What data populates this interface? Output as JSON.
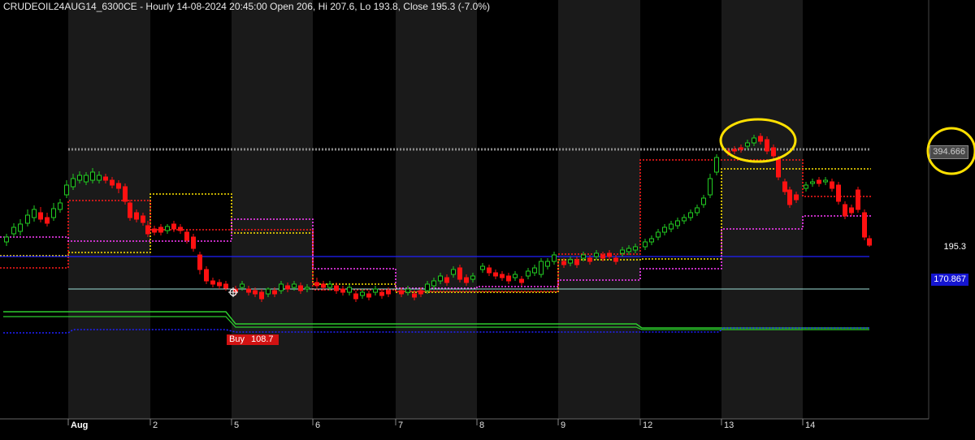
{
  "header": {
    "title": "CRUDEOIL24AUG14_6300CE - Hourly 14-08-2024 20:45:00 Open 206, Hi 207.6, Lo 193.8, Close 195.3 (-7.0%)"
  },
  "price_labels": {
    "hline": "394.666",
    "close": "195.3",
    "blue_line": "170.867"
  },
  "buy_signal": {
    "label": "Buy",
    "value": "108.7"
  },
  "colors": {
    "background": "#000000",
    "session_shade": "#1a1a1a",
    "up_candle": "#22cc22",
    "down_candle": "#ff1111",
    "yellow_level": "#ffe400",
    "red_level": "#ff1a1a",
    "magenta_level": "#ff3cff",
    "blue_line": "#2020ff",
    "cyan_line": "#9fe0d8",
    "green_band": "#2ecc2e",
    "gray_level": "#8a8a8a",
    "highlight_circle": "#ffe000"
  },
  "chart_data": {
    "type": "candlestick",
    "title": "CRUDEOIL24AUG14_6300CE - Hourly",
    "x_axis": {
      "labels": [
        "Aug",
        "2",
        "5",
        "6",
        "7",
        "8",
        "9",
        "12",
        "13",
        "14"
      ]
    },
    "levels": {
      "gray_dotted": 394.666,
      "blue_line": 195.3,
      "cyan_line": 170.867
    },
    "last_bar": {
      "open": 206,
      "high": 207.6,
      "low": 193.8,
      "close": 195.3,
      "change_pct": -7.0
    },
    "annotations": [
      {
        "type": "buy_signal",
        "label": "Buy",
        "value": 108.7
      },
      {
        "type": "highlight_circle",
        "target": "peak near 394.666 on Aug 13"
      },
      {
        "type": "highlight_circle",
        "target": "394.666 price label"
      }
    ]
  }
}
